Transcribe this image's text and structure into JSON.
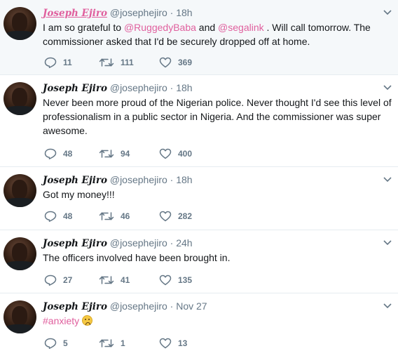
{
  "colors": {
    "accent": "#e0609e",
    "muted": "#657786",
    "text": "#14171a",
    "highlight_bg": "#f5f8fa"
  },
  "tweets": [
    {
      "name": "Joseph Ejiro",
      "handle": "@josephejiro",
      "separator": "·",
      "time": "18h",
      "text_parts": {
        "p1": "I am so grateful to ",
        "m1": "@RuggedyBaba",
        "p2": " and ",
        "m2": "@segalink",
        "p3": " . Will call tomorrow. The commissioner asked that I'd be securely dropped off at home."
      },
      "replies": "11",
      "retweets": "111",
      "likes": "369"
    },
    {
      "name": "Joseph Ejiro",
      "handle": "@josephejiro",
      "separator": "·",
      "time": "18h",
      "text": "Never been more proud of the Nigerian police. Never thought I'd see this level of professionalism in a public sector in Nigeria. And the commissioner was super awesome.",
      "replies": "48",
      "retweets": "94",
      "likes": "400"
    },
    {
      "name": "Joseph Ejiro",
      "handle": "@josephejiro",
      "separator": "·",
      "time": "18h",
      "text": "Got my money!!!",
      "replies": "48",
      "retweets": "46",
      "likes": "282"
    },
    {
      "name": "Joseph Ejiro",
      "handle": "@josephejiro",
      "separator": "·",
      "time": "24h",
      "text": "The officers involved have been brought in.",
      "replies": "27",
      "retweets": "41",
      "likes": "135"
    },
    {
      "name": "Joseph Ejiro",
      "handle": "@josephejiro",
      "separator": "·",
      "time": "Nov 27",
      "hashtag": "#anxiety",
      "emoji": "worried-face-emoji",
      "replies": "5",
      "retweets": "1",
      "likes": "13"
    }
  ],
  "icons": {
    "reply": "reply-icon",
    "retweet": "retweet-icon",
    "like": "heart-icon",
    "more": "chevron-down-icon",
    "avatar": "avatar"
  }
}
